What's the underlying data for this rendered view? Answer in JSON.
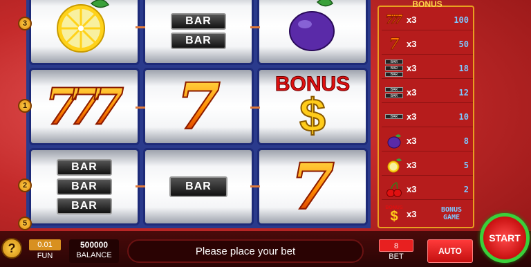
{
  "reels": {
    "row1": [
      "lemon",
      "BAR",
      "plum"
    ],
    "row2": [
      "triple-seven",
      "seven",
      "bonus"
    ],
    "row3": [
      "triple-bar",
      "BAR",
      "seven"
    ],
    "bar_label": "BAR",
    "seven_glyph": "7",
    "bonus_text": "BONUS",
    "dollar_glyph": "$"
  },
  "line_markers": [
    "3",
    "1",
    "2",
    "5"
  ],
  "paytable": {
    "header": "BONUS",
    "rows": [
      {
        "symbol": "triple-seven",
        "mult": "x3",
        "value": "100"
      },
      {
        "symbol": "seven",
        "mult": "x3",
        "value": "50"
      },
      {
        "symbol": "triple-bar",
        "mult": "x3",
        "value": "18"
      },
      {
        "symbol": "double-bar",
        "mult": "x3",
        "value": "12"
      },
      {
        "symbol": "bar",
        "mult": "x3",
        "value": "10"
      },
      {
        "symbol": "plum",
        "mult": "x3",
        "value": "8"
      },
      {
        "symbol": "lemon",
        "mult": "x3",
        "value": "5"
      },
      {
        "symbol": "cherry",
        "mult": "x3",
        "value": "2"
      },
      {
        "symbol": "bonus",
        "mult": "x3",
        "value_line1": "BONUS",
        "value_line2": "GAME"
      }
    ]
  },
  "bottom": {
    "help": "?",
    "fun_value": "0.01",
    "fun_label": "FUN",
    "balance_value": "500000",
    "balance_label": "BALANCE",
    "message": "Please place your bet",
    "bet_value": "8",
    "bet_label": "BET",
    "auto_label": "AUTO",
    "start_label": "START"
  },
  "colors": {
    "background": "#c42a2a",
    "reel_frame": "#2a3a8c",
    "paytable_bg": "#b61c1c",
    "paytable_value": "#7ec8ff",
    "start_ring": "#3ad03a"
  }
}
